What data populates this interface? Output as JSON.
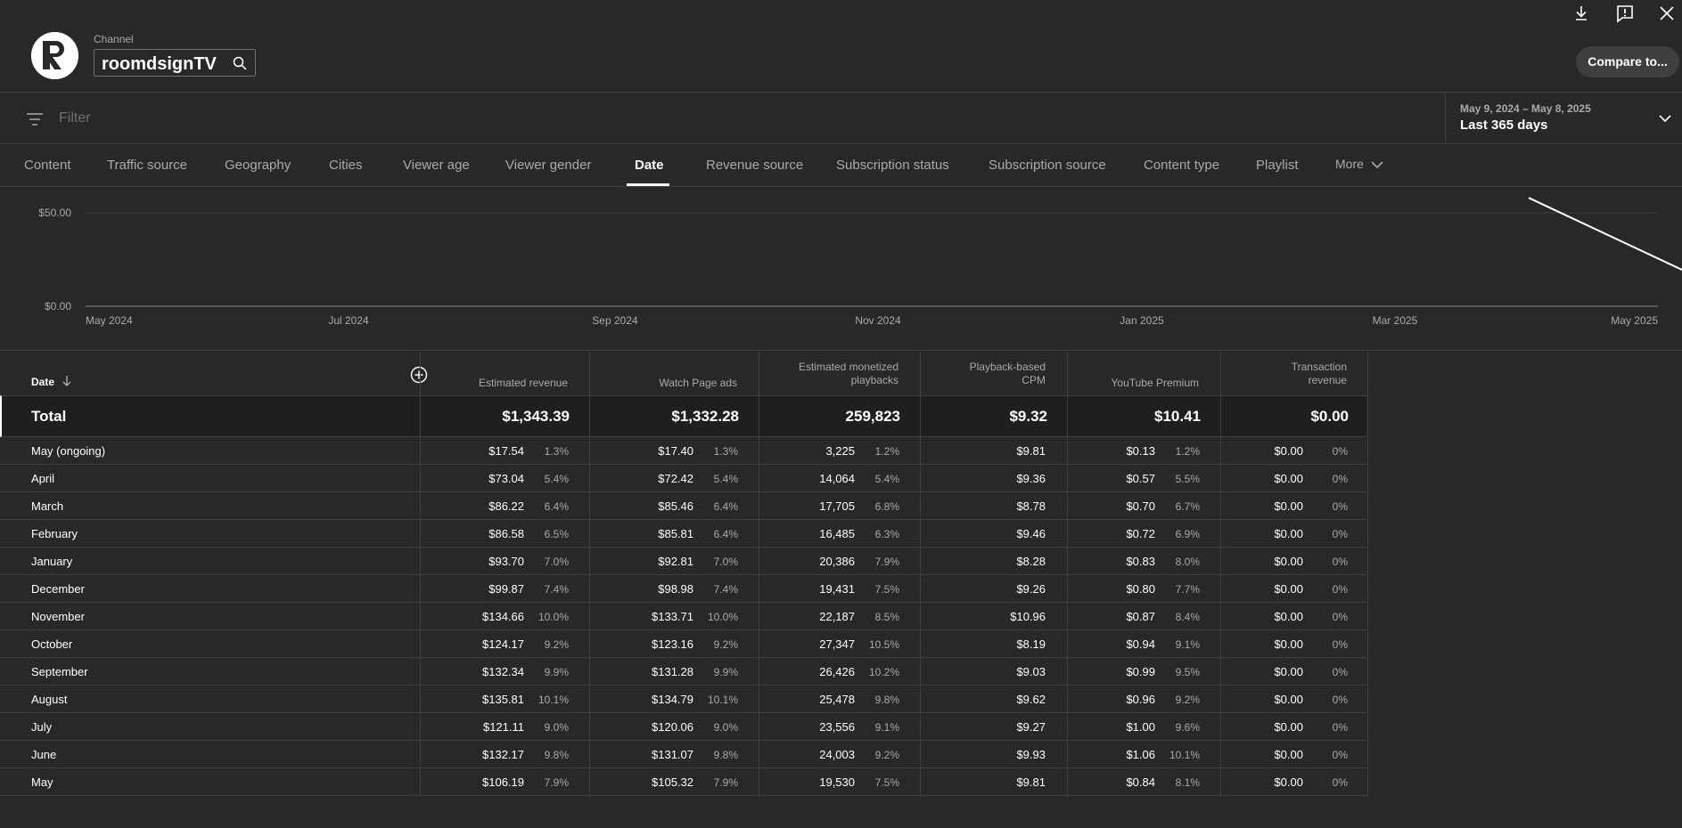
{
  "header": {
    "channel_label": "Channel",
    "channel_name": "roomdsignTV",
    "compare_label": "Compare to..."
  },
  "filter": {
    "placeholder": "Filter"
  },
  "date_range": {
    "sub": "May 9, 2024 – May 8, 2025",
    "main": "Last 365 days"
  },
  "tabs": [
    {
      "label": "Content"
    },
    {
      "label": "Traffic source"
    },
    {
      "label": "Geography"
    },
    {
      "label": "Cities"
    },
    {
      "label": "Viewer age"
    },
    {
      "label": "Viewer gender"
    },
    {
      "label": "Date",
      "active": true
    },
    {
      "label": "Revenue source"
    },
    {
      "label": "Subscription status"
    },
    {
      "label": "Subscription source"
    },
    {
      "label": "Content type"
    },
    {
      "label": "Playlist"
    },
    {
      "label": "More"
    }
  ],
  "chart_data": {
    "type": "line",
    "y_ticks": [
      "$50.00",
      "$0.00"
    ],
    "x_ticks": [
      "May 2024",
      "Jul 2024",
      "Sep 2024",
      "Nov 2024",
      "Jan 2025",
      "Mar 2025",
      "May 2025"
    ],
    "ylim": [
      0,
      50
    ],
    "series": [
      {
        "x": [
          "2025-04-01",
          "2025-05-08"
        ],
        "values": [
          58,
          18
        ]
      }
    ]
  },
  "table": {
    "columns": {
      "date": "Date",
      "est_revenue": "Estimated revenue",
      "watch_ads": "Watch Page ads",
      "monetized_1": "Estimated monetized",
      "monetized_2": "playbacks",
      "cpm_1": "Playback-based",
      "cpm_2": "CPM",
      "premium": "YouTube Premium",
      "trans_1": "Transaction",
      "trans_2": "revenue"
    },
    "total": {
      "label": "Total",
      "est_revenue": "$1,343.39",
      "watch_ads": "$1,332.28",
      "playbacks": "259,823",
      "cpm": "$9.32",
      "premium": "$10.41",
      "transaction": "$0.00"
    },
    "rows": [
      {
        "date": "May (ongoing)",
        "rev": "$17.54",
        "rev_p": "1.3%",
        "ads": "$17.40",
        "ads_p": "1.3%",
        "pb": "3,225",
        "pb_p": "1.2%",
        "cpm": "$9.81",
        "prem": "$0.13",
        "prem_p": "1.2%",
        "tr": "$0.00",
        "tr_p": "0%"
      },
      {
        "date": "April",
        "rev": "$73.04",
        "rev_p": "5.4%",
        "ads": "$72.42",
        "ads_p": "5.4%",
        "pb": "14,064",
        "pb_p": "5.4%",
        "cpm": "$9.36",
        "prem": "$0.57",
        "prem_p": "5.5%",
        "tr": "$0.00",
        "tr_p": "0%"
      },
      {
        "date": "March",
        "rev": "$86.22",
        "rev_p": "6.4%",
        "ads": "$85.46",
        "ads_p": "6.4%",
        "pb": "17,705",
        "pb_p": "6.8%",
        "cpm": "$8.78",
        "prem": "$0.70",
        "prem_p": "6.7%",
        "tr": "$0.00",
        "tr_p": "0%"
      },
      {
        "date": "February",
        "rev": "$86.58",
        "rev_p": "6.5%",
        "ads": "$85.81",
        "ads_p": "6.4%",
        "pb": "16,485",
        "pb_p": "6.3%",
        "cpm": "$9.46",
        "prem": "$0.72",
        "prem_p": "6.9%",
        "tr": "$0.00",
        "tr_p": "0%"
      },
      {
        "date": "January",
        "rev": "$93.70",
        "rev_p": "7.0%",
        "ads": "$92.81",
        "ads_p": "7.0%",
        "pb": "20,386",
        "pb_p": "7.9%",
        "cpm": "$8.28",
        "prem": "$0.83",
        "prem_p": "8.0%",
        "tr": "$0.00",
        "tr_p": "0%"
      },
      {
        "date": "December",
        "rev": "$99.87",
        "rev_p": "7.4%",
        "ads": "$98.98",
        "ads_p": "7.4%",
        "pb": "19,431",
        "pb_p": "7.5%",
        "cpm": "$9.26",
        "prem": "$0.80",
        "prem_p": "7.7%",
        "tr": "$0.00",
        "tr_p": "0%"
      },
      {
        "date": "November",
        "rev": "$134.66",
        "rev_p": "10.0%",
        "ads": "$133.71",
        "ads_p": "10.0%",
        "pb": "22,187",
        "pb_p": "8.5%",
        "cpm": "$10.96",
        "prem": "$0.87",
        "prem_p": "8.4%",
        "tr": "$0.00",
        "tr_p": "0%"
      },
      {
        "date": "October",
        "rev": "$124.17",
        "rev_p": "9.2%",
        "ads": "$123.16",
        "ads_p": "9.2%",
        "pb": "27,347",
        "pb_p": "10.5%",
        "cpm": "$8.19",
        "prem": "$0.94",
        "prem_p": "9.1%",
        "tr": "$0.00",
        "tr_p": "0%"
      },
      {
        "date": "September",
        "rev": "$132.34",
        "rev_p": "9.9%",
        "ads": "$131.28",
        "ads_p": "9.9%",
        "pb": "26,426",
        "pb_p": "10.2%",
        "cpm": "$9.03",
        "prem": "$0.99",
        "prem_p": "9.5%",
        "tr": "$0.00",
        "tr_p": "0%"
      },
      {
        "date": "August",
        "rev": "$135.81",
        "rev_p": "10.1%",
        "ads": "$134.79",
        "ads_p": "10.1%",
        "pb": "25,478",
        "pb_p": "9.8%",
        "cpm": "$9.62",
        "prem": "$0.96",
        "prem_p": "9.2%",
        "tr": "$0.00",
        "tr_p": "0%"
      },
      {
        "date": "July",
        "rev": "$121.11",
        "rev_p": "9.0%",
        "ads": "$120.06",
        "ads_p": "9.0%",
        "pb": "23,556",
        "pb_p": "9.1%",
        "cpm": "$9.27",
        "prem": "$1.00",
        "prem_p": "9.6%",
        "tr": "$0.00",
        "tr_p": "0%"
      },
      {
        "date": "June",
        "rev": "$132.17",
        "rev_p": "9.8%",
        "ads": "$131.07",
        "ads_p": "9.8%",
        "pb": "24,003",
        "pb_p": "9.2%",
        "cpm": "$9.93",
        "prem": "$1.06",
        "prem_p": "10.1%",
        "tr": "$0.00",
        "tr_p": "0%"
      },
      {
        "date": "May",
        "rev": "$106.19",
        "rev_p": "7.9%",
        "ads": "$105.32",
        "ads_p": "7.9%",
        "pb": "19,530",
        "pb_p": "7.5%",
        "cpm": "$9.81",
        "prem": "$0.84",
        "prem_p": "8.1%",
        "tr": "$0.00",
        "tr_p": "0%"
      }
    ]
  }
}
